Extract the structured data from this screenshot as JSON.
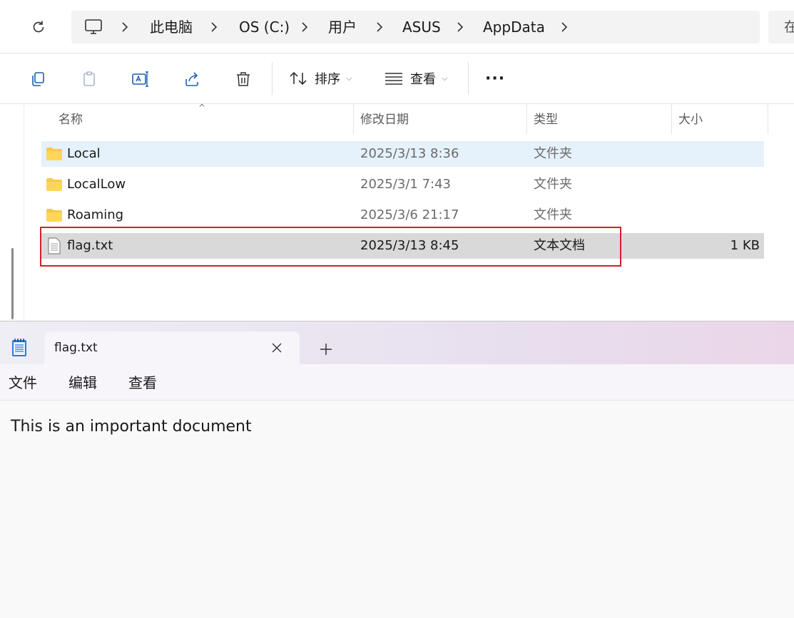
{
  "explorer": {
    "breadcrumb": [
      "此电脑",
      "OS (C:)",
      "用户",
      "ASUS",
      "AppData"
    ],
    "search_partial": "在",
    "toolbar": {
      "sort_label": "排序",
      "view_label": "查看",
      "more_label": "···"
    },
    "columns": {
      "name": "名称",
      "date": "修改日期",
      "type": "类型",
      "size": "大小"
    },
    "files": [
      {
        "name": "Local",
        "date": "2025/3/13 8:36",
        "type": "文件夹",
        "size": "",
        "icon": "folder-icon",
        "state": "selected"
      },
      {
        "name": "LocalLow",
        "date": "2025/3/1 7:43",
        "type": "文件夹",
        "size": "",
        "icon": "folder-icon",
        "state": "normal"
      },
      {
        "name": "Roaming",
        "date": "2025/3/6 21:17",
        "type": "文件夹",
        "size": "",
        "icon": "folder-icon",
        "state": "normal"
      },
      {
        "name": "flag.txt",
        "date": "2025/3/13 8:45",
        "type": "文本文档",
        "size": "1 KB",
        "icon": "text-file-icon",
        "state": "highlighted"
      }
    ],
    "highlight_color": "#d51f2b"
  },
  "notepad": {
    "tab_title": "flag.txt",
    "menu": [
      "文件",
      "编辑",
      "查看"
    ],
    "content": "This is an important document"
  }
}
